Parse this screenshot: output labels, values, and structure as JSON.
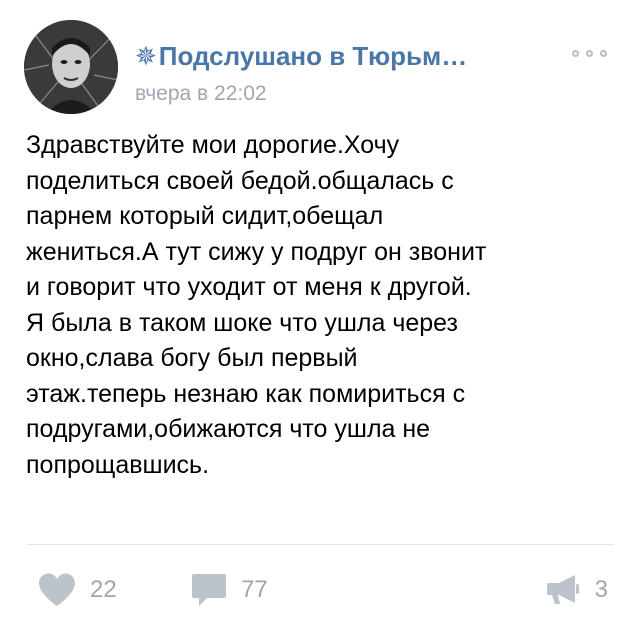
{
  "post": {
    "community_name": "Подслушано в Тюрьм…",
    "community_prefix_glyph": "✵",
    "timestamp": "вчера в 22:02",
    "text_lines": [
      "Здравствуйте мои дорогие.Хочу",
      "поделиться своей бедой.общалась с",
      "парнем который сидит,обещал",
      "жениться.А тут сижу у подруг он звонит",
      "и говорит что уходит от меня к другой.",
      "Я была в таком шоке что ушла через",
      "окно,слава богу был первый",
      "этаж.теперь незнаю как помириться с",
      "подругами,обижаются что ушла не",
      "попрощавшись."
    ]
  },
  "actions": {
    "likes": "22",
    "comments": "77",
    "shares": "3"
  },
  "icons": {
    "more": "more-options-icon",
    "like": "heart-icon",
    "comment": "comment-bubble-icon",
    "share": "megaphone-share-icon"
  },
  "colors": {
    "accent": "#4a76a8",
    "muted": "#9ea6b0",
    "icon_gray": "#bcc3cb",
    "divider": "#dfe3e8"
  }
}
